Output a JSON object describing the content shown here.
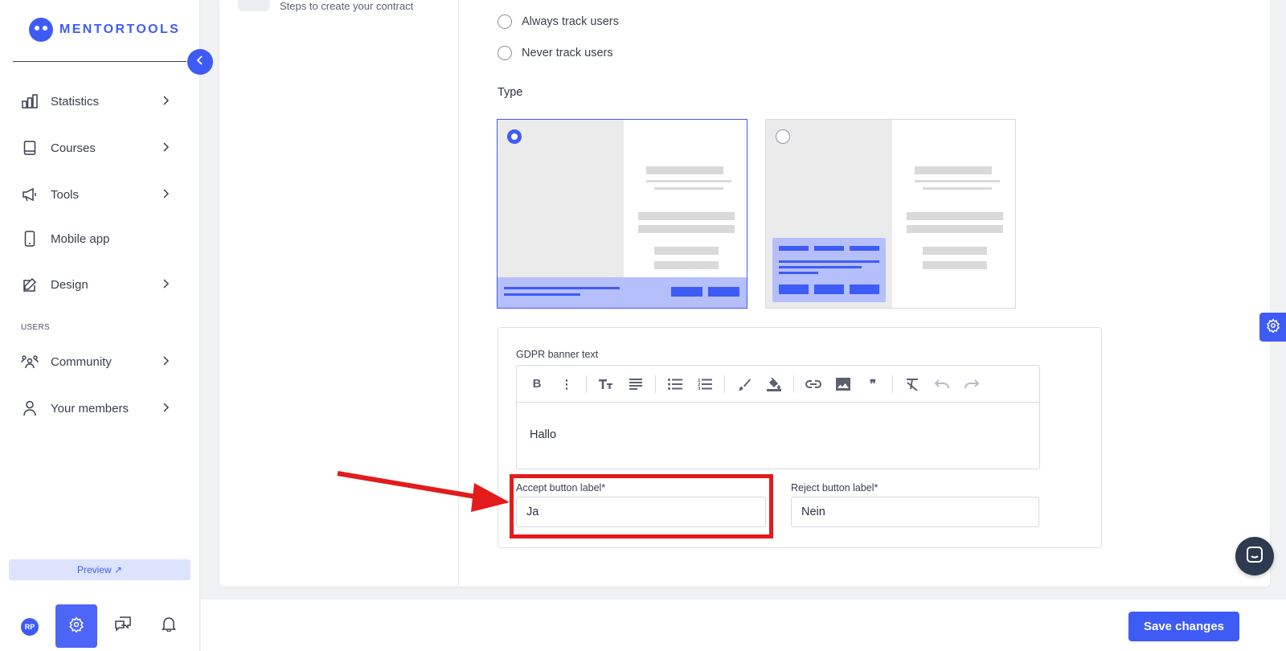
{
  "brand": {
    "name": "MENTORTOOLS"
  },
  "sidebar": {
    "items": [
      {
        "label": "Statistics"
      },
      {
        "label": "Courses"
      },
      {
        "label": "Tools"
      },
      {
        "label": "Mobile app"
      },
      {
        "label": "Design"
      }
    ],
    "section_users": "USERS",
    "user_items": [
      {
        "label": "Community"
      },
      {
        "label": "Your members"
      }
    ],
    "preview_label": "Preview ↗",
    "avatar_initials": "RP"
  },
  "steps": {
    "text": "Steps to create your contract"
  },
  "tracking": {
    "options": [
      "Always track users",
      "Never track users"
    ]
  },
  "type": {
    "label": "Type",
    "selected_index": 0
  },
  "gdpr": {
    "banner_label": "GDPR banner text",
    "banner_value": "Hallo",
    "accept_label": "Accept button label*",
    "accept_value": "Ja",
    "reject_label": "Reject button label*",
    "reject_value": "Nein"
  },
  "footer": {
    "save_label": "Save changes"
  },
  "colors": {
    "accent": "#3f5bf6",
    "highlight": "#e21b1b",
    "overlay": "#b5bffb"
  }
}
